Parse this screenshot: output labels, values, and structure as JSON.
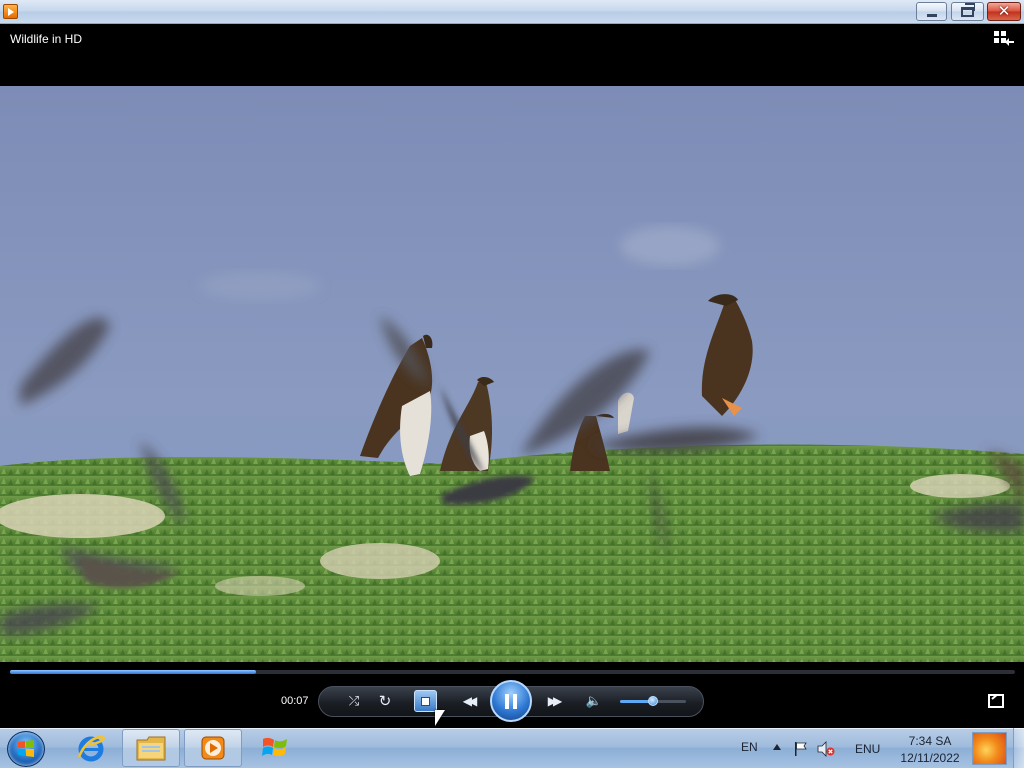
{
  "window": {
    "app_icon": "wmp-icon",
    "controls": {
      "minimize": "minimize-icon",
      "maximize": "restore-icon",
      "close": "close-icon",
      "close_glyph": "✕"
    }
  },
  "player": {
    "now_playing_title": "Wildlife in HD",
    "switch_to_library_icon": "switch-to-library-icon",
    "seek_progress": 0.245,
    "time_elapsed": "00:07",
    "state": "playing",
    "volume_level": 0.5,
    "controls": {
      "shuffle": "shuffle-icon",
      "repeat": "repeat-icon",
      "stop": "stop-icon",
      "previous": "previous-icon",
      "play_pause": "pause-icon",
      "next": "next-icon",
      "mute": "speaker-icon",
      "fullscreen": "fullscreen-icon"
    },
    "glyphs": {
      "shuffle": "⤮",
      "repeat": "↻",
      "previous": "◀◀",
      "next": "▶▶",
      "mute": "🔈"
    }
  },
  "taskbar": {
    "pinned": [
      {
        "name": "Internet Explorer",
        "icon": "internet-explorer-icon",
        "active": false
      },
      {
        "name": "Windows Explorer",
        "icon": "folder-icon",
        "active": true
      },
      {
        "name": "Windows Media Player",
        "icon": "wmp-icon",
        "active": true
      },
      {
        "name": "Windows",
        "icon": "windows-logo-icon",
        "active": false
      }
    ],
    "tray": {
      "language": "EN",
      "keyboard_layout": "ENU",
      "time": "7:34 SA",
      "date": "12/11/2022",
      "icons": [
        "show-hidden-icons-arrow",
        "action-center-flag-icon",
        "volume-muted-icon"
      ]
    }
  },
  "colors": {
    "accent": "#2f79d4",
    "titlebar": "#c5d6ec",
    "close_button": "#c1311b",
    "taskbar": "#9fbbdc"
  }
}
